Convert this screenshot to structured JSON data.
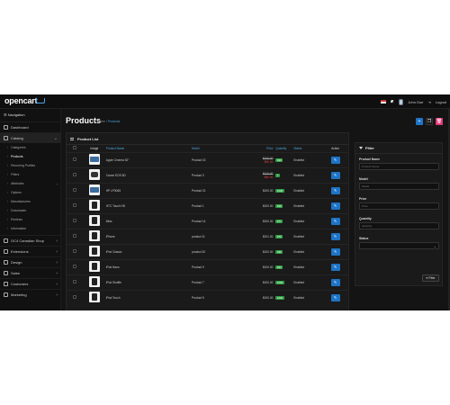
{
  "header": {
    "logo": "opencart",
    "user_name": "John Doe",
    "logout": "Logout"
  },
  "sidebar": {
    "title": "Navigation",
    "items": [
      {
        "label": "Dashboard",
        "icon": "dashboard-icon"
      },
      {
        "label": "Catalog",
        "icon": "tag-icon"
      },
      {
        "label": "OC4 Canadian Shop",
        "icon": "store-icon"
      },
      {
        "label": "Extensions",
        "icon": "puzzle-icon"
      },
      {
        "label": "Design",
        "icon": "monitor-icon"
      },
      {
        "label": "Sales",
        "icon": "cart-icon"
      },
      {
        "label": "Customers",
        "icon": "user-icon"
      },
      {
        "label": "Marketing",
        "icon": "share-icon"
      }
    ],
    "catalog_sub": [
      {
        "label": "Categories"
      },
      {
        "label": "Products"
      },
      {
        "label": "Recurring Profiles"
      },
      {
        "label": "Filters"
      },
      {
        "label": "Attributes"
      },
      {
        "label": "Options"
      },
      {
        "label": "Manufacturers"
      },
      {
        "label": "Downloads"
      },
      {
        "label": "Reviews"
      },
      {
        "label": "Information"
      }
    ]
  },
  "page": {
    "title": "Products",
    "breadcrumb_home": "Home",
    "breadcrumb_current": "Products"
  },
  "product_list": {
    "title": "Product List",
    "columns": {
      "image": "Image",
      "name": "Product Name",
      "model": "Model",
      "price": "Price",
      "quantity": "Quantity",
      "status": "Status",
      "action": "Action"
    },
    "rows": [
      {
        "name": "Apple Cinema 30\"",
        "model": "Product 15",
        "price_old": "$100.00",
        "price_new": "$90.00",
        "qty": "990",
        "status": "Enabled",
        "thumb": "monitor"
      },
      {
        "name": "Canon EOS 5D",
        "model": "Product 3",
        "price_old": "$100.00",
        "price_new": "$80.00",
        "qty": "7",
        "status": "Enabled",
        "thumb": "camera"
      },
      {
        "name": "HP LP3065",
        "model": "Product 21",
        "price_old": "$100.00",
        "price_new": "",
        "qty": "1000",
        "status": "Enabled",
        "thumb": "monitor"
      },
      {
        "name": "HTC Touch HD",
        "model": "Product 1",
        "price_old": "$100.00",
        "price_new": "",
        "qty": "939",
        "status": "Enabled",
        "thumb": "phone"
      },
      {
        "name": "iMac",
        "model": "Product 14",
        "price_old": "$100.00",
        "price_new": "",
        "qty": "977",
        "status": "Enabled",
        "thumb": "phone"
      },
      {
        "name": "iPhone",
        "model": "product 11",
        "price_old": "$101.00",
        "price_new": "",
        "qty": "970",
        "status": "Enabled",
        "thumb": "phone"
      },
      {
        "name": "iPod Classic",
        "model": "product 20",
        "price_old": "$100.00",
        "price_new": "",
        "qty": "995",
        "status": "Enabled",
        "thumb": "phone"
      },
      {
        "name": "iPod Nano",
        "model": "Product 9",
        "price_old": "$100.00",
        "price_new": "",
        "qty": "994",
        "status": "Enabled",
        "thumb": "phone"
      },
      {
        "name": "iPod Shuffle",
        "model": "Product 7",
        "price_old": "$100.00",
        "price_new": "",
        "qty": "1000",
        "status": "Enabled",
        "thumb": "phone"
      },
      {
        "name": "iPod Touch",
        "model": "Product 5",
        "price_old": "$100.00",
        "price_new": "",
        "qty": "1000",
        "status": "Enabled",
        "thumb": "phone"
      }
    ]
  },
  "filter": {
    "title": "Filter",
    "name_label": "Product Name",
    "name_placeholder": "Product Name",
    "model_label": "Model",
    "model_placeholder": "Model",
    "price_label": "Price",
    "price_placeholder": "Price",
    "quantity_label": "Quantity",
    "quantity_placeholder": "Quantity",
    "status_label": "Status",
    "status_value": "",
    "button": "Filter"
  }
}
